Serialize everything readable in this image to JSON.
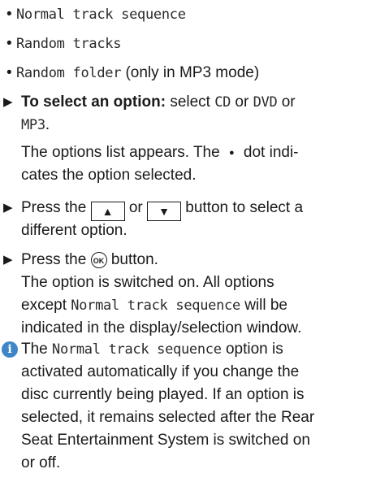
{
  "options_list": [
    {
      "label": "Normal track sequence"
    },
    {
      "label": "Random tracks"
    },
    {
      "label": "Random folder",
      "note": "(only in MP3 mode)"
    }
  ],
  "step1": {
    "bold": "To select an option:",
    "text_a": "select",
    "cd": "CD",
    "or1": "or",
    "dvd": "DVD",
    "or2": "or",
    "mp3": "MP3",
    "period": ".",
    "result_a": "The options list appears. The",
    "dot": "●",
    "result_b": "dot indi-",
    "result_c": "cates the option selected."
  },
  "step2": {
    "text_a": "Press the",
    "up_key": "▲",
    "or": "or",
    "down_key": "▼",
    "text_b": "button to select a",
    "text_c": "different option."
  },
  "step3": {
    "text_a": "Press the",
    "ok_key": "OK",
    "text_b": "button.",
    "result_1": "The option is switched on. All options",
    "result_2a": "except",
    "result_2mono": "Normal track sequence",
    "result_2b": "will be",
    "result_3": "indicated in the display/selection window."
  },
  "info": {
    "icon": "info-icon",
    "icon_glyph": "i",
    "a": "The",
    "mono": "Normal track sequence",
    "b": "option is",
    "l2": "activated automatically if you change the",
    "l3": "disc currently being played. If an option is",
    "l4": "selected, it remains selected after the Rear",
    "l5": "Seat Entertainment System is switched on",
    "l6": "or off."
  },
  "colors": {
    "info_icon_bg": "#3f86c8",
    "text": "#1a1a1a"
  }
}
